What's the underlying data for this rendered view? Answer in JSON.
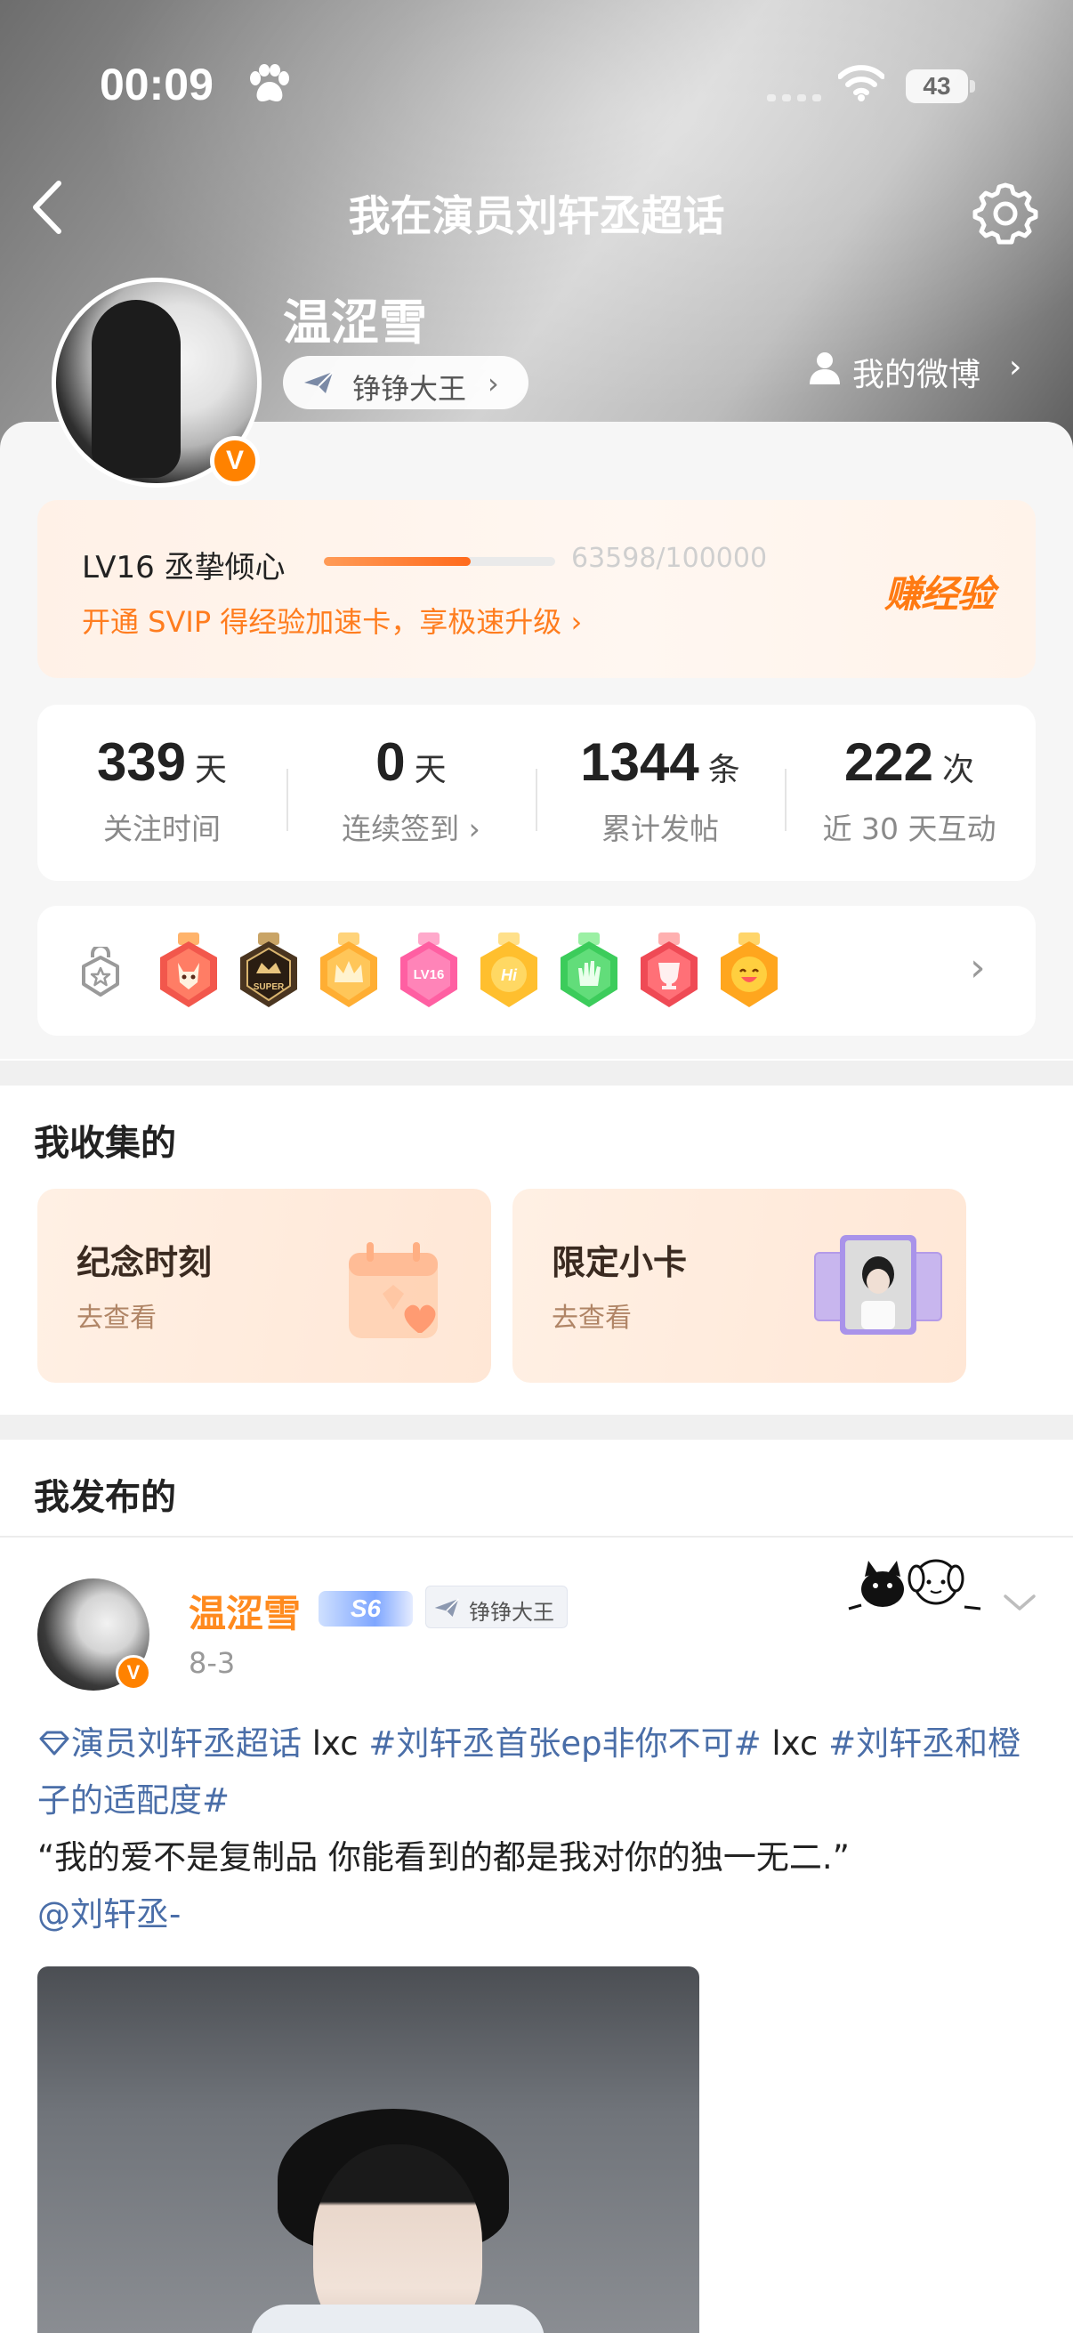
{
  "status_bar": {
    "time": "00:09",
    "battery": "43",
    "icons": [
      "paw-icon",
      "signal-icon",
      "wifi-icon",
      "battery-icon"
    ]
  },
  "nav": {
    "title": "我在演员刘轩丞超话",
    "icons": [
      "back-icon",
      "settings-icon"
    ]
  },
  "profile": {
    "name": "温涩雪",
    "verified_badge": "V",
    "title_chip": "铮铮大王",
    "my_weibo_label": "我的微博"
  },
  "level": {
    "label": "LV16 丞挚倾心",
    "progress_text": "63598/100000",
    "progress_fraction": 0.636,
    "svip_text": "开通 SVIP 得经验加速卡，享极速升级",
    "earn_label": "赚经验"
  },
  "stats": [
    {
      "value": "339",
      "unit": "天",
      "label": "关注时间"
    },
    {
      "value": "0",
      "unit": "天",
      "label": "连续签到 ›"
    },
    {
      "value": "1344",
      "unit": "条",
      "label": "累计发帖"
    },
    {
      "value": "222",
      "unit": "次",
      "label": "近 30 天互动"
    }
  ],
  "medals": {
    "icons": [
      "medal-lock-icon",
      "fox-medal-icon",
      "super-medal-icon",
      "crown-medal-icon",
      "lv16-medal-icon",
      "hi-medal-icon",
      "hand-medal-icon",
      "trophy-medal-icon",
      "laugh-medal-icon"
    ],
    "lv_text": "LV16",
    "hi_text": "Hi",
    "super_text": "SUPER"
  },
  "collected": {
    "title": "我收集的",
    "cards": [
      {
        "title": "纪念时刻",
        "sub": "去查看"
      },
      {
        "title": "限定小卡",
        "sub": "去查看"
      }
    ]
  },
  "published": {
    "title": "我发布的"
  },
  "post": {
    "author": "温涩雪",
    "level_badge": "S6",
    "chip": "铮铮大王",
    "date": "8-3",
    "supertopic": "演员刘轩丞超话",
    "text1": " lxc ",
    "hashtag1": "#刘轩丞首张ep非你不可#",
    "text2": " lxc ",
    "hashtag2": "#刘轩丞和橙子的适配度#",
    "quote": "“我的爱不是复制品 你能看到的都是我对你的独一无二.”",
    "mention": "@刘轩丞-"
  },
  "colors": {
    "accent_orange": "#ff7d1f",
    "link_blue": "#4a6ea8"
  }
}
